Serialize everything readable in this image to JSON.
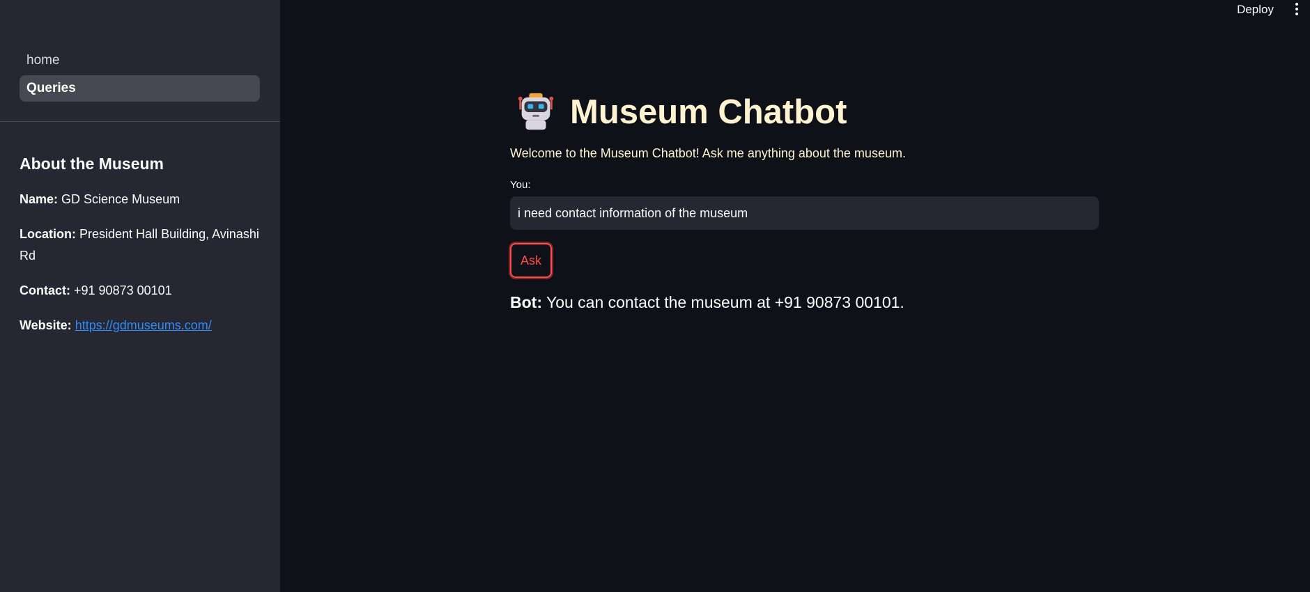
{
  "sidebar": {
    "nav": [
      {
        "label": "home"
      },
      {
        "label": "Queries"
      }
    ],
    "about": {
      "title": "About the Museum",
      "name_key": "Name:",
      "name_value": "GD Science Museum",
      "location_key": "Location:",
      "location_value": "President Hall Building, Avinashi Rd",
      "contact_key": "Contact:",
      "contact_value": "+91 90873 00101",
      "website_key": "Website:",
      "website_value": "https://gdmuseums.com/"
    }
  },
  "header": {
    "deploy_label": "Deploy",
    "menu_icon": "vertical-dots-icon"
  },
  "main": {
    "icon": "robot-icon",
    "title": "Museum Chatbot",
    "welcome": "Welcome to the Museum Chatbot! Ask me anything about the museum.",
    "input_label": "You:",
    "input_value": "i need contact information of the museum",
    "ask_label": "Ask",
    "bot_key": "Bot:",
    "bot_reply": "You can contact the museum at +91 90873 00101."
  },
  "colors": {
    "background": "#0e1117",
    "sidebar": "#262730",
    "accent": "#ff4b4b",
    "title_text": "#fdf3d0",
    "link": "#2d8cff"
  }
}
